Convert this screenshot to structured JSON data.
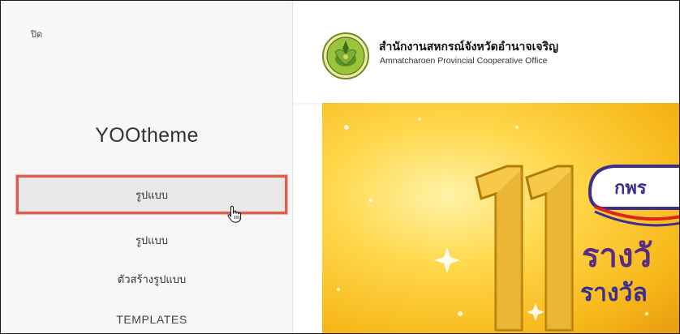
{
  "sidebar": {
    "close_label": "ปิด",
    "brand": "YOOtheme",
    "items": [
      {
        "label": "รูปแบบ",
        "active": true
      },
      {
        "label": "รูปแบบ",
        "active": false
      },
      {
        "label": "ตัวสร้างรูปแบบ",
        "active": false
      },
      {
        "label": "TEMPLATES",
        "active": false
      }
    ]
  },
  "site": {
    "org_name_th": "สำนักงานสหกรณ์จังหวัดอำนาจเจริญ",
    "org_name_en": "Amnatcharoen Provincial Cooperative Office",
    "banner": {
      "number": "11",
      "badge_text": "กพร",
      "headline_1": "รางวั",
      "headline_2": "รางวัล"
    }
  },
  "colors": {
    "highlight_border": "#e05a4d",
    "banner_gold": "#f7b81a",
    "headline_purple": "#5a2d82"
  }
}
